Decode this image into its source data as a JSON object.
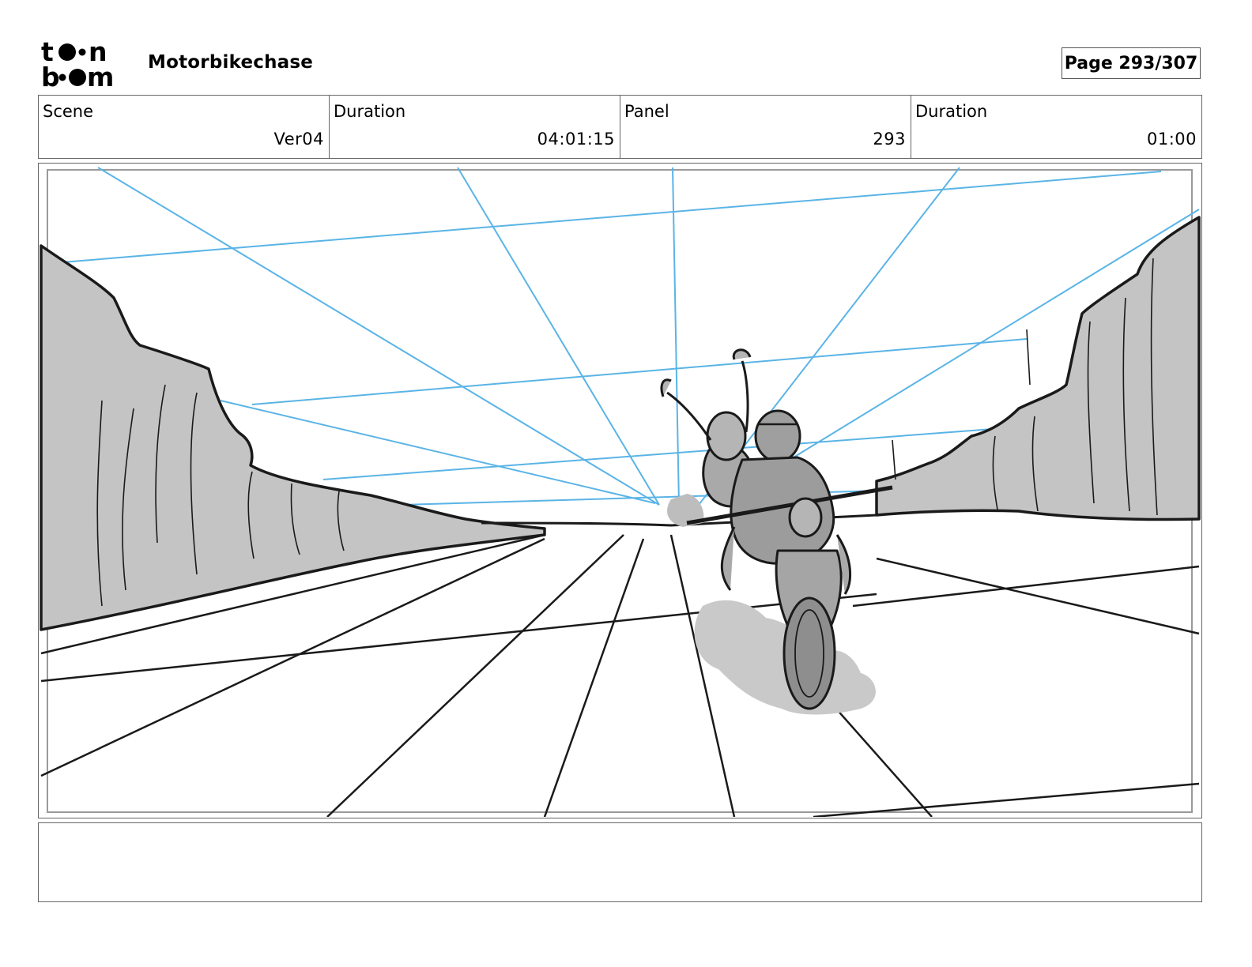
{
  "header": {
    "logo_text": "toon boom",
    "project_title": "Motorbikechase",
    "page_label": "Page 293/307"
  },
  "info": {
    "scene_label": "Scene",
    "scene_value": "Ver04",
    "scene_duration_label": "Duration",
    "scene_duration_value": "04:01:15",
    "panel_label": "Panel",
    "panel_value": "293",
    "panel_duration_label": "Duration",
    "panel_duration_value": "01:00"
  },
  "panel": {
    "image_name": "storyboard-sketch-motorbike-riders-canyon-road",
    "colors": {
      "guide_lines": "#5ab4e6",
      "shading": "#c4c4c4",
      "ink": "#1a1a1a"
    }
  },
  "notes": {
    "text": ""
  }
}
